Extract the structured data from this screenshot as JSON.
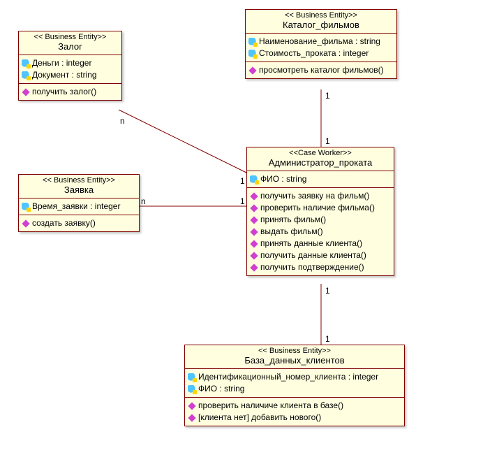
{
  "classes": {
    "zalog": {
      "stereo": "<< Business Entity>>",
      "name": "Залог",
      "attrs": [
        {
          "label": "Деньги : integer"
        },
        {
          "label": "Документ : string"
        }
      ],
      "ops": [
        {
          "label": "получить залог()"
        }
      ]
    },
    "katalog": {
      "stereo": "<< Business Entity>>",
      "name": "Каталог_фильмов",
      "attrs": [
        {
          "label": "Наименование_фильма : string"
        },
        {
          "label": "Стоимость_проката : integer"
        }
      ],
      "ops": [
        {
          "label": "просмотреть каталог фильмов()"
        }
      ]
    },
    "admin": {
      "stereo": "<<Case Worker>>",
      "name": "Администратор_проката",
      "attrs": [
        {
          "label": "ФИО : string"
        }
      ],
      "ops": [
        {
          "label": "получить заявку на фильм()"
        },
        {
          "label": "проверить наличие фильма()"
        },
        {
          "label": "принять фильм()"
        },
        {
          "label": "выдать фильм()"
        },
        {
          "label": "принять данные клиента()"
        },
        {
          "label": "получить данные клиента()"
        },
        {
          "label": "получить подтверждение()"
        }
      ]
    },
    "zayavka": {
      "stereo": "<< Business Entity>>",
      "name": "Заявка",
      "attrs": [
        {
          "label": "Время_заявки : integer"
        }
      ],
      "ops": [
        {
          "label": "создать заявку()"
        }
      ]
    },
    "baza": {
      "stereo": "<< Business Entity>>",
      "name": "База_данных_клиентов",
      "attrs": [
        {
          "label": "Идентификационный_номер_клиента : integer"
        },
        {
          "label": "ФИО : string"
        }
      ],
      "ops": [
        {
          "label": "проверить наличиче клиента в базе()"
        },
        {
          "label": "[клиента нет] добавить нового()"
        }
      ]
    }
  },
  "mult": {
    "zalog_admin_n": "n",
    "zalog_admin_1": "1",
    "katalog_admin_top": "1",
    "katalog_admin_bot": "1",
    "zayavka_admin_n": "n",
    "zayavka_admin_1": "1",
    "admin_baza_top": "1",
    "admin_baza_bot": "1"
  }
}
